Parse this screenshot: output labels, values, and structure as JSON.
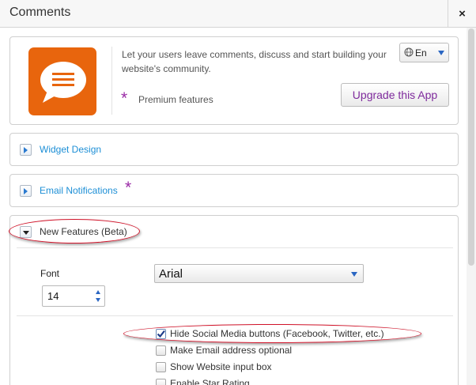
{
  "window": {
    "title": "Comments",
    "close_label": "×"
  },
  "app": {
    "icon": "speech-bubble-icon",
    "description": "Let your users leave comments, discuss and start building your website's community.",
    "premium_star": "*",
    "premium_label": "Premium features",
    "language": {
      "icon": "globe-icon",
      "selected": "En"
    },
    "upgrade_label": "Upgrade this App"
  },
  "sections": {
    "widget_design": {
      "label": "Widget Design"
    },
    "email_notifications": {
      "label": "Email Notifications",
      "premium_star": "*"
    },
    "new_features": {
      "label": "New Features (Beta)"
    }
  },
  "new_features": {
    "font_label": "Font",
    "font_family": "Arial",
    "font_size": "14",
    "checkboxes": [
      {
        "label": "Hide Social Media buttons (Facebook, Twitter, etc.)",
        "checked": true
      },
      {
        "label": "Make Email address optional",
        "checked": false
      },
      {
        "label": "Show Website input box",
        "checked": false
      },
      {
        "label": "Enable Star Rating",
        "checked": false
      }
    ]
  },
  "colors": {
    "accent_orange": "#e8650d",
    "premium_purple": "#9a2aa6",
    "link_blue": "#1d8fd6",
    "annotation_red": "#d1142a"
  }
}
